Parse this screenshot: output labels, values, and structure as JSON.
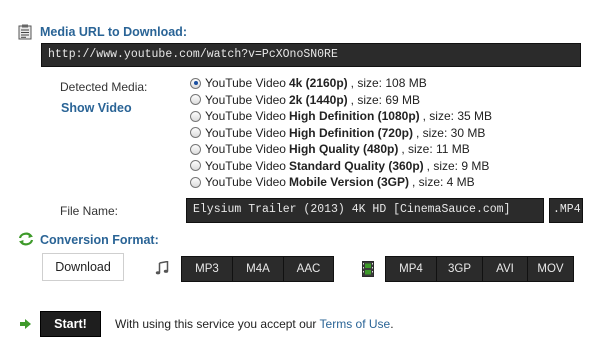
{
  "url_section": {
    "title": "Media URL to Download:",
    "url": "http://www.youtube.com/watch?v=PcXOnoSN0RE",
    "icon": "clipboard-icon"
  },
  "media": {
    "label": "Detected Media:",
    "show_video": "Show Video",
    "options": [
      {
        "prefix": "YouTube Video",
        "quality": "4k (2160p)",
        "size": ", size: 108 MB",
        "selected": true
      },
      {
        "prefix": "YouTube Video",
        "quality": "2k (1440p)",
        "size": ", size: 69 MB",
        "selected": false
      },
      {
        "prefix": "YouTube Video",
        "quality": "High Definition (1080p)",
        "size": ", size: 35 MB",
        "selected": false
      },
      {
        "prefix": "YouTube Video",
        "quality": "High Definition (720p)",
        "size": ", size: 30 MB",
        "selected": false
      },
      {
        "prefix": "YouTube Video",
        "quality": "High Quality (480p)",
        "size": ", size: 11 MB",
        "selected": false
      },
      {
        "prefix": "YouTube Video",
        "quality": "Standard Quality (360p)",
        "size": ", size: 9 MB",
        "selected": false
      },
      {
        "prefix": "YouTube Video",
        "quality": "Mobile Version (3GP)",
        "size": ", size: 4 MB",
        "selected": false
      }
    ]
  },
  "file": {
    "label": "File Name:",
    "name": "Elysium Trailer (2013) 4K HD [CinemaSauce.com]",
    "ext": ".MP4"
  },
  "conversion": {
    "title": "Conversion Format:",
    "icon": "refresh-icon",
    "download": "Download",
    "audio_icon": "music-note-icon",
    "audio_formats": [
      "MP3",
      "M4A",
      "AAC"
    ],
    "video_icon": "film-strip-icon",
    "video_formats": [
      "MP4",
      "3GP",
      "AVI",
      "MOV"
    ]
  },
  "footer": {
    "start": "Start!",
    "notice": "With using this service you accept our",
    "terms": "Terms of Use",
    "period": ".",
    "arrow_icon": "arrow-right-icon"
  },
  "colors": {
    "accent": "#2a6496",
    "dark_field": "#2b2b2b",
    "green_icon": "#3e9a2a"
  }
}
